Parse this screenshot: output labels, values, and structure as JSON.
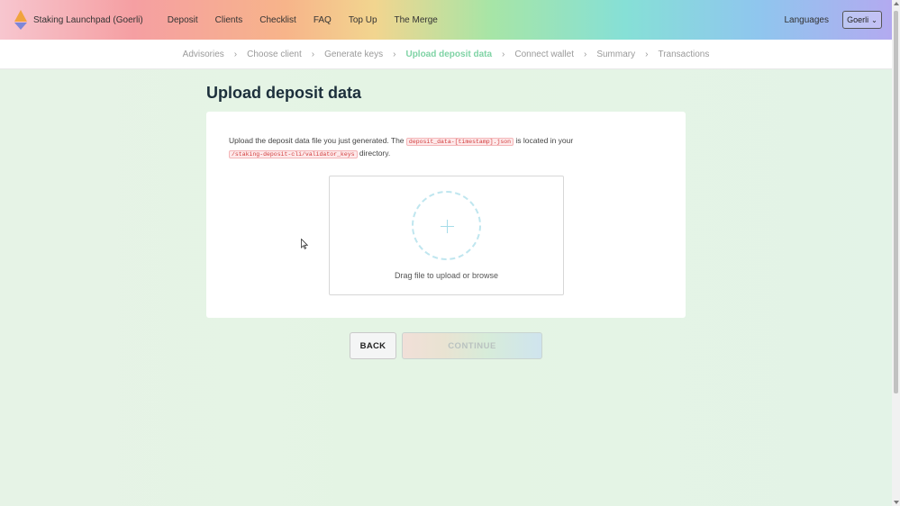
{
  "app": {
    "brand": "Staking Launchpad (Goerli)",
    "nav": [
      "Deposit",
      "Clients",
      "Checklist",
      "FAQ",
      "Top Up",
      "The Merge"
    ],
    "languages_label": "Languages",
    "network_select": "Goerli"
  },
  "steps": [
    {
      "label": "Advisories"
    },
    {
      "label": "Choose client"
    },
    {
      "label": "Generate keys"
    },
    {
      "label": "Upload deposit data"
    },
    {
      "label": "Connect wallet"
    },
    {
      "label": "Summary"
    },
    {
      "label": "Transactions"
    }
  ],
  "page": {
    "title": "Upload deposit data",
    "instruction_part1": "Upload the deposit data file you just generated. The",
    "filename_code": "deposit_data-[timestamp].json",
    "instruction_part2": "is located in your",
    "directory_code": "/staking-deposit-cli/validator_keys",
    "instruction_part3": "directory.",
    "dropzone_text": "Drag file to upload or browse"
  },
  "actions": {
    "back": "BACK",
    "continue": "CONTINUE"
  },
  "colors": {
    "active_step": "#7fd3a5",
    "title": "#1c2f3b",
    "code_text": "#d23c3c"
  },
  "icons": {
    "logo": "ethereum-logo-icon",
    "chevron": "chevron-down-icon",
    "plus": "plus-icon"
  }
}
